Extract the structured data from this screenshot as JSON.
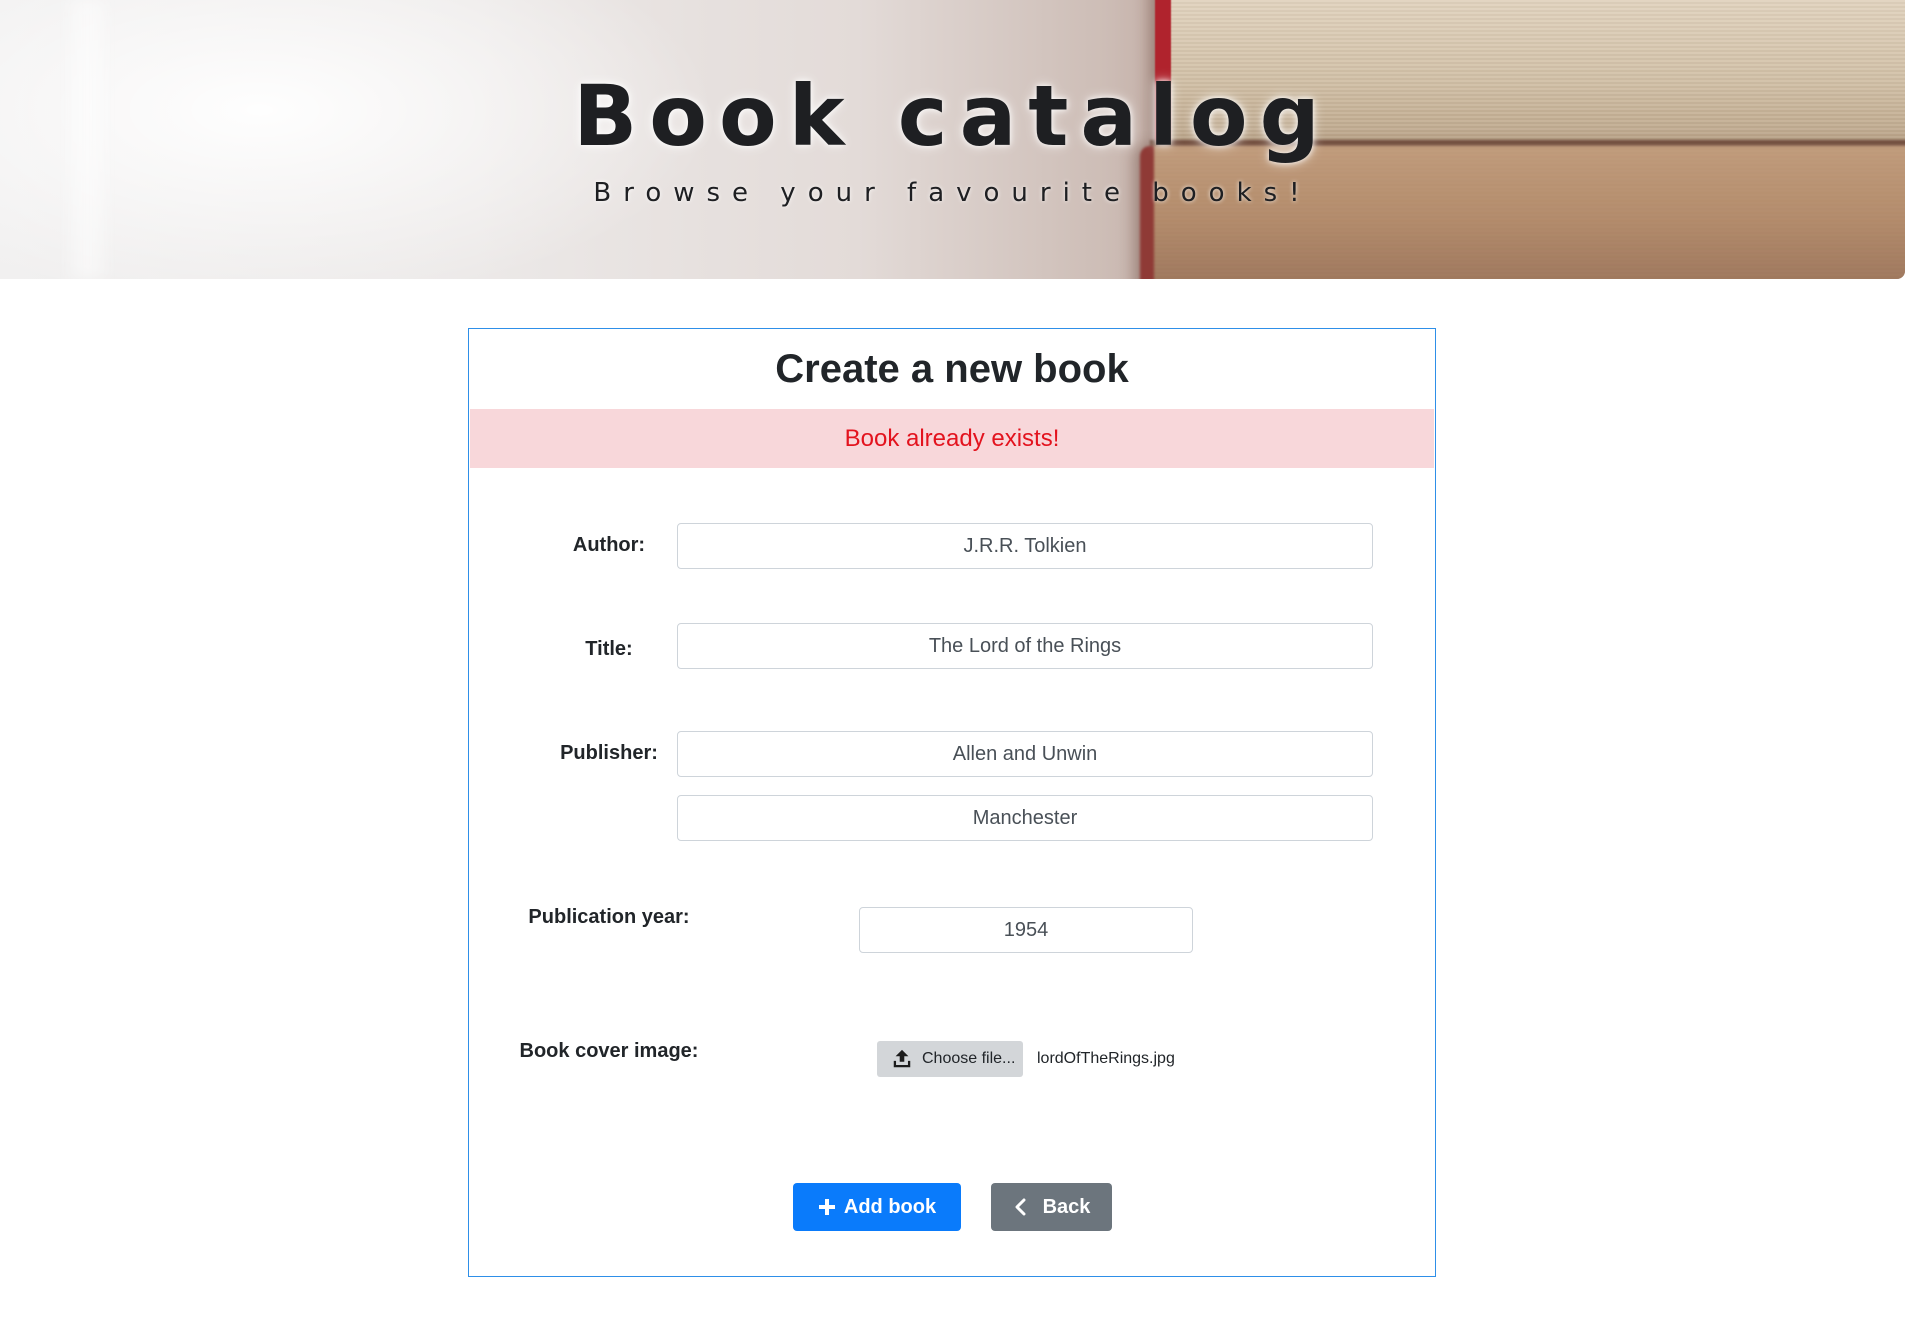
{
  "header": {
    "title": "Book catalog",
    "subtitle": "Browse your favourite books!"
  },
  "form": {
    "heading": "Create a new book",
    "alert": "Book already exists!",
    "author": {
      "label": "Author:",
      "value": "J.R.R. Tolkien"
    },
    "title": {
      "label": "Title:",
      "value": "The Lord of the Rings"
    },
    "publisher": {
      "label": "Publisher:",
      "name_value": "Allen and Unwin",
      "city_value": "Manchester"
    },
    "publication_year": {
      "label": "Publication year:",
      "value": "1954"
    },
    "cover": {
      "label": "Book cover image:",
      "button_label": "Choose file...",
      "file_name": "lordOfTheRings.jpg",
      "icon": "upload-icon"
    },
    "buttons": {
      "add": {
        "label": "Add book",
        "icon": "plus-icon"
      },
      "back": {
        "label": "Back",
        "icon": "chevron-left-icon"
      }
    }
  },
  "colors": {
    "card_border": "#2e8fe8",
    "alert_bg": "#f8d7da",
    "alert_text": "#e3131e",
    "primary": "#0a7bfb",
    "secondary": "#6c757d",
    "file_button": "#d3d6d9"
  }
}
